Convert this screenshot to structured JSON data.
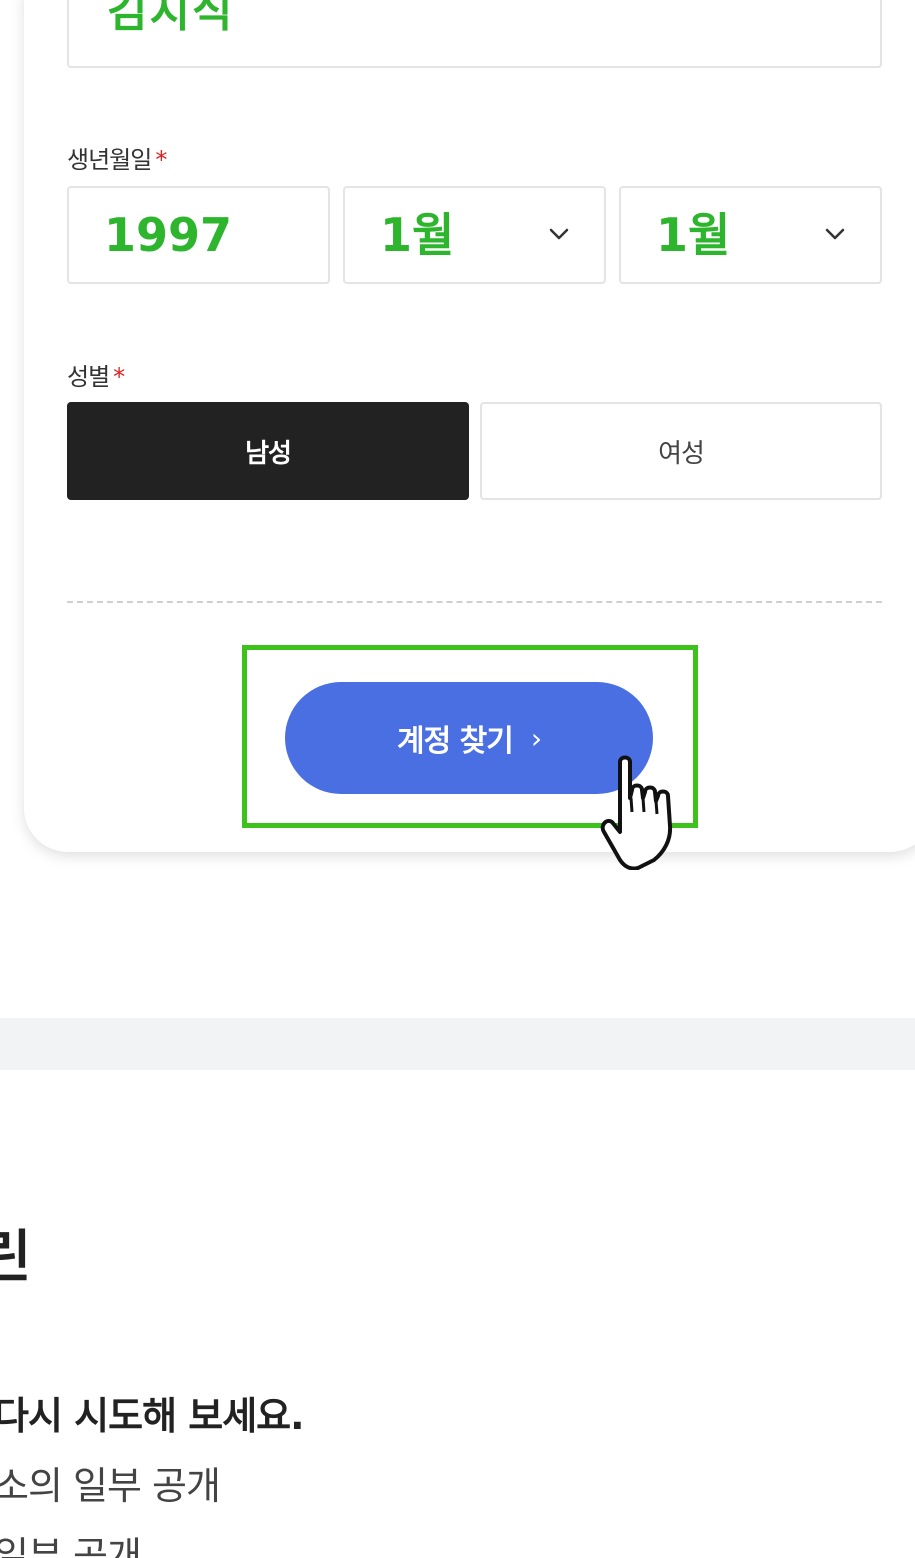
{
  "form": {
    "name_value": "김지식",
    "birth_label": "생년월일",
    "birth_year": "1997",
    "birth_month": "1월",
    "birth_day": "1월",
    "gender_label": "성별",
    "required_mark": "*",
    "gender_male": "남성",
    "gender_female": "여성",
    "gender_selected": "남성",
    "find_button_label": "계정 찾기",
    "find_button_arrow": "›"
  },
  "lower": {
    "heading_fragment": "린",
    "line1": "다시 시도해 보세요.",
    "line2": "소의 일부 공개",
    "line3": "일부 공개"
  },
  "colors": {
    "value_green": "#2db52d",
    "button_blue": "#4a6fe3",
    "highlight_green": "#3cc21a",
    "selected_dark": "#222222",
    "required_red": "#e02020"
  },
  "icons": {
    "chevron": "chevron-down-icon",
    "cursor": "hand-pointer-icon"
  }
}
